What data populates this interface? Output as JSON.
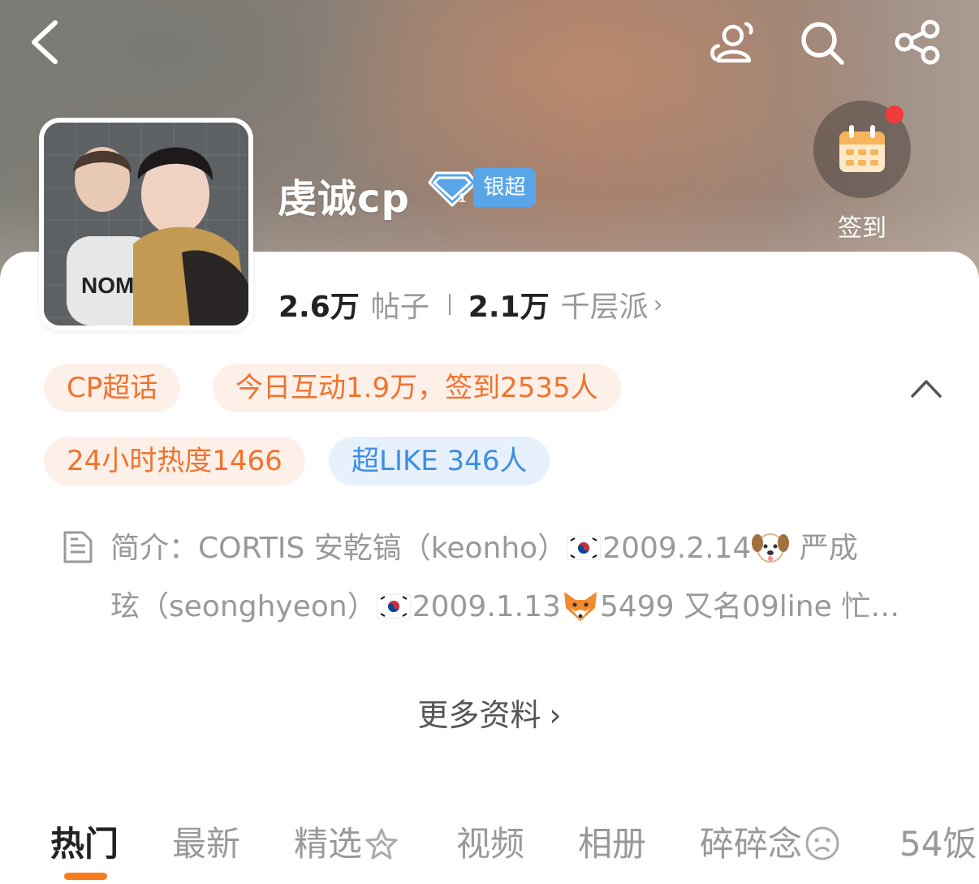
{
  "header": {
    "title": "虔诚cp",
    "badge_label": "银超",
    "checkin_label": "签到"
  },
  "stats": {
    "posts_count": "2.6万",
    "posts_label": "帖子",
    "members_count": "2.1万",
    "members_label": "千层派"
  },
  "tags": {
    "category": "CP超话",
    "activity": "今日互动1.9万，签到2535人",
    "heat": "24小时热度1466",
    "superlike": "超LIKE 346人"
  },
  "intro": {
    "prefix": "简介：CORTIS  安乾镐（keonho）",
    "date1": "2009.2.14",
    "mid": " 严成",
    "line2_start": "玹（seonghyeon）",
    "date2": "2009.1.13",
    "tail": "5499 又名09line 忙…"
  },
  "more_label": "更多资料",
  "tabs": [
    "热门",
    "最新",
    "精选",
    "视频",
    "相册",
    "碎碎念",
    "54饭"
  ],
  "colors": {
    "accent_orange": "#f97c1c",
    "tag_orange_text": "#f0722e",
    "tag_blue_text": "#3c8ee0",
    "badge_blue": "#5aa5e8",
    "notif_red": "#f23b3b"
  },
  "icons": {
    "back": "back-arrow-icon",
    "contacts": "people-icon",
    "search": "search-icon",
    "share": "share-icon",
    "calendar": "calendar-icon",
    "document": "document-icon"
  }
}
